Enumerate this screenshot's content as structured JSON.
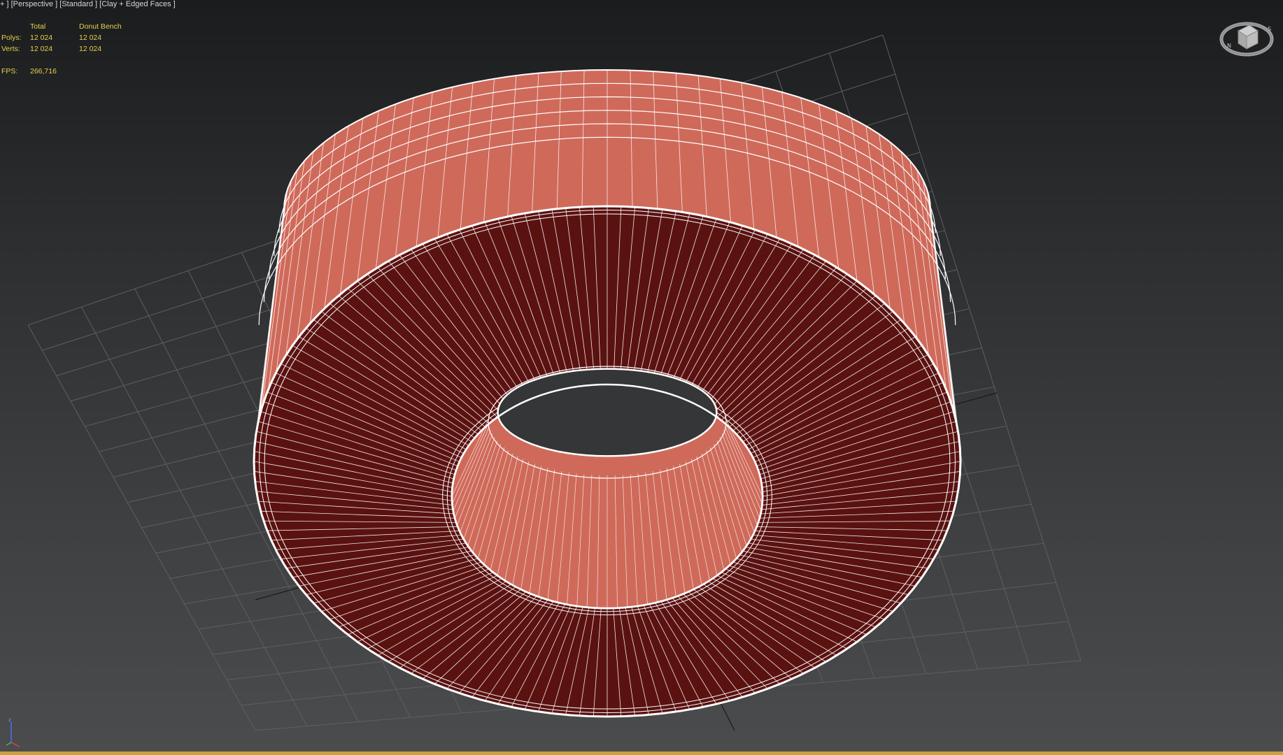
{
  "viewport": {
    "label": "+ ] [Perspective ] [Standard ] [Clay + Edged Faces ]"
  },
  "stats": {
    "headers": [
      "",
      "Total",
      "Donut Bench"
    ],
    "rows": [
      {
        "label": "Polys:",
        "total": "12 024",
        "object": "12 024"
      },
      {
        "label": "Verts:",
        "total": "12 024",
        "object": "12 024"
      }
    ],
    "fps_label": "FPS:",
    "fps_value": "266,716"
  },
  "colors": {
    "stats_text": "#e8d24a",
    "label_text": "#d7d7d7",
    "clay_light": "#cf6a5a",
    "clay_dark": "#5a1210",
    "wire": "#ffffff",
    "grid": "#5e5f61"
  },
  "icons": {
    "viewcube": "viewcube-icon",
    "axis": "axis-tripod-icon"
  }
}
